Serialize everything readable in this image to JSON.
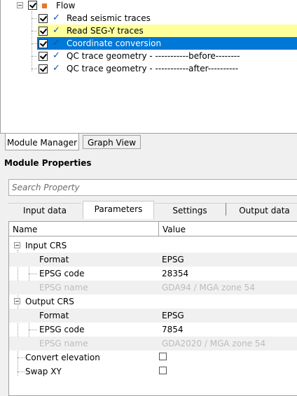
{
  "flow_tree": {
    "root_label": "Flow",
    "items": [
      {
        "label": "Read seismic traces"
      },
      {
        "label": "Read SEG-Y traces"
      },
      {
        "label": "Coordinate conversion"
      },
      {
        "label": "QC trace geometry - -----------before--------"
      },
      {
        "label": "QC trace geometry - -----------after----------"
      }
    ],
    "highlight_color": "#ffff9c",
    "selected_color": "#0078d7"
  },
  "bottom_tabs": {
    "module_manager": "Module Manager",
    "graph_view": "Graph View"
  },
  "module_properties": {
    "title": "Module Properties",
    "search_placeholder": "Search Property",
    "tabs": {
      "input_data": "Input data",
      "parameters": "Parameters",
      "settings": "Settings",
      "output_data": "Output data"
    },
    "grid": {
      "col_name": "Name",
      "col_value": "Value",
      "input_crs": {
        "label": "Input CRS",
        "format_label": "Format",
        "format_value": "EPSG",
        "code_label": "EPSG code",
        "code_value": "28354",
        "name_label": "EPSG name",
        "name_value": "GDA94 / MGA zone 54"
      },
      "output_crs": {
        "label": "Output CRS",
        "format_label": "Format",
        "format_value": "EPSG",
        "code_label": "EPSG code",
        "code_value": "7854",
        "name_label": "EPSG name",
        "name_value": "GDA2020 / MGA zone 54"
      },
      "convert_elevation_label": "Convert elevation",
      "swap_xy_label": "Swap XY"
    }
  }
}
